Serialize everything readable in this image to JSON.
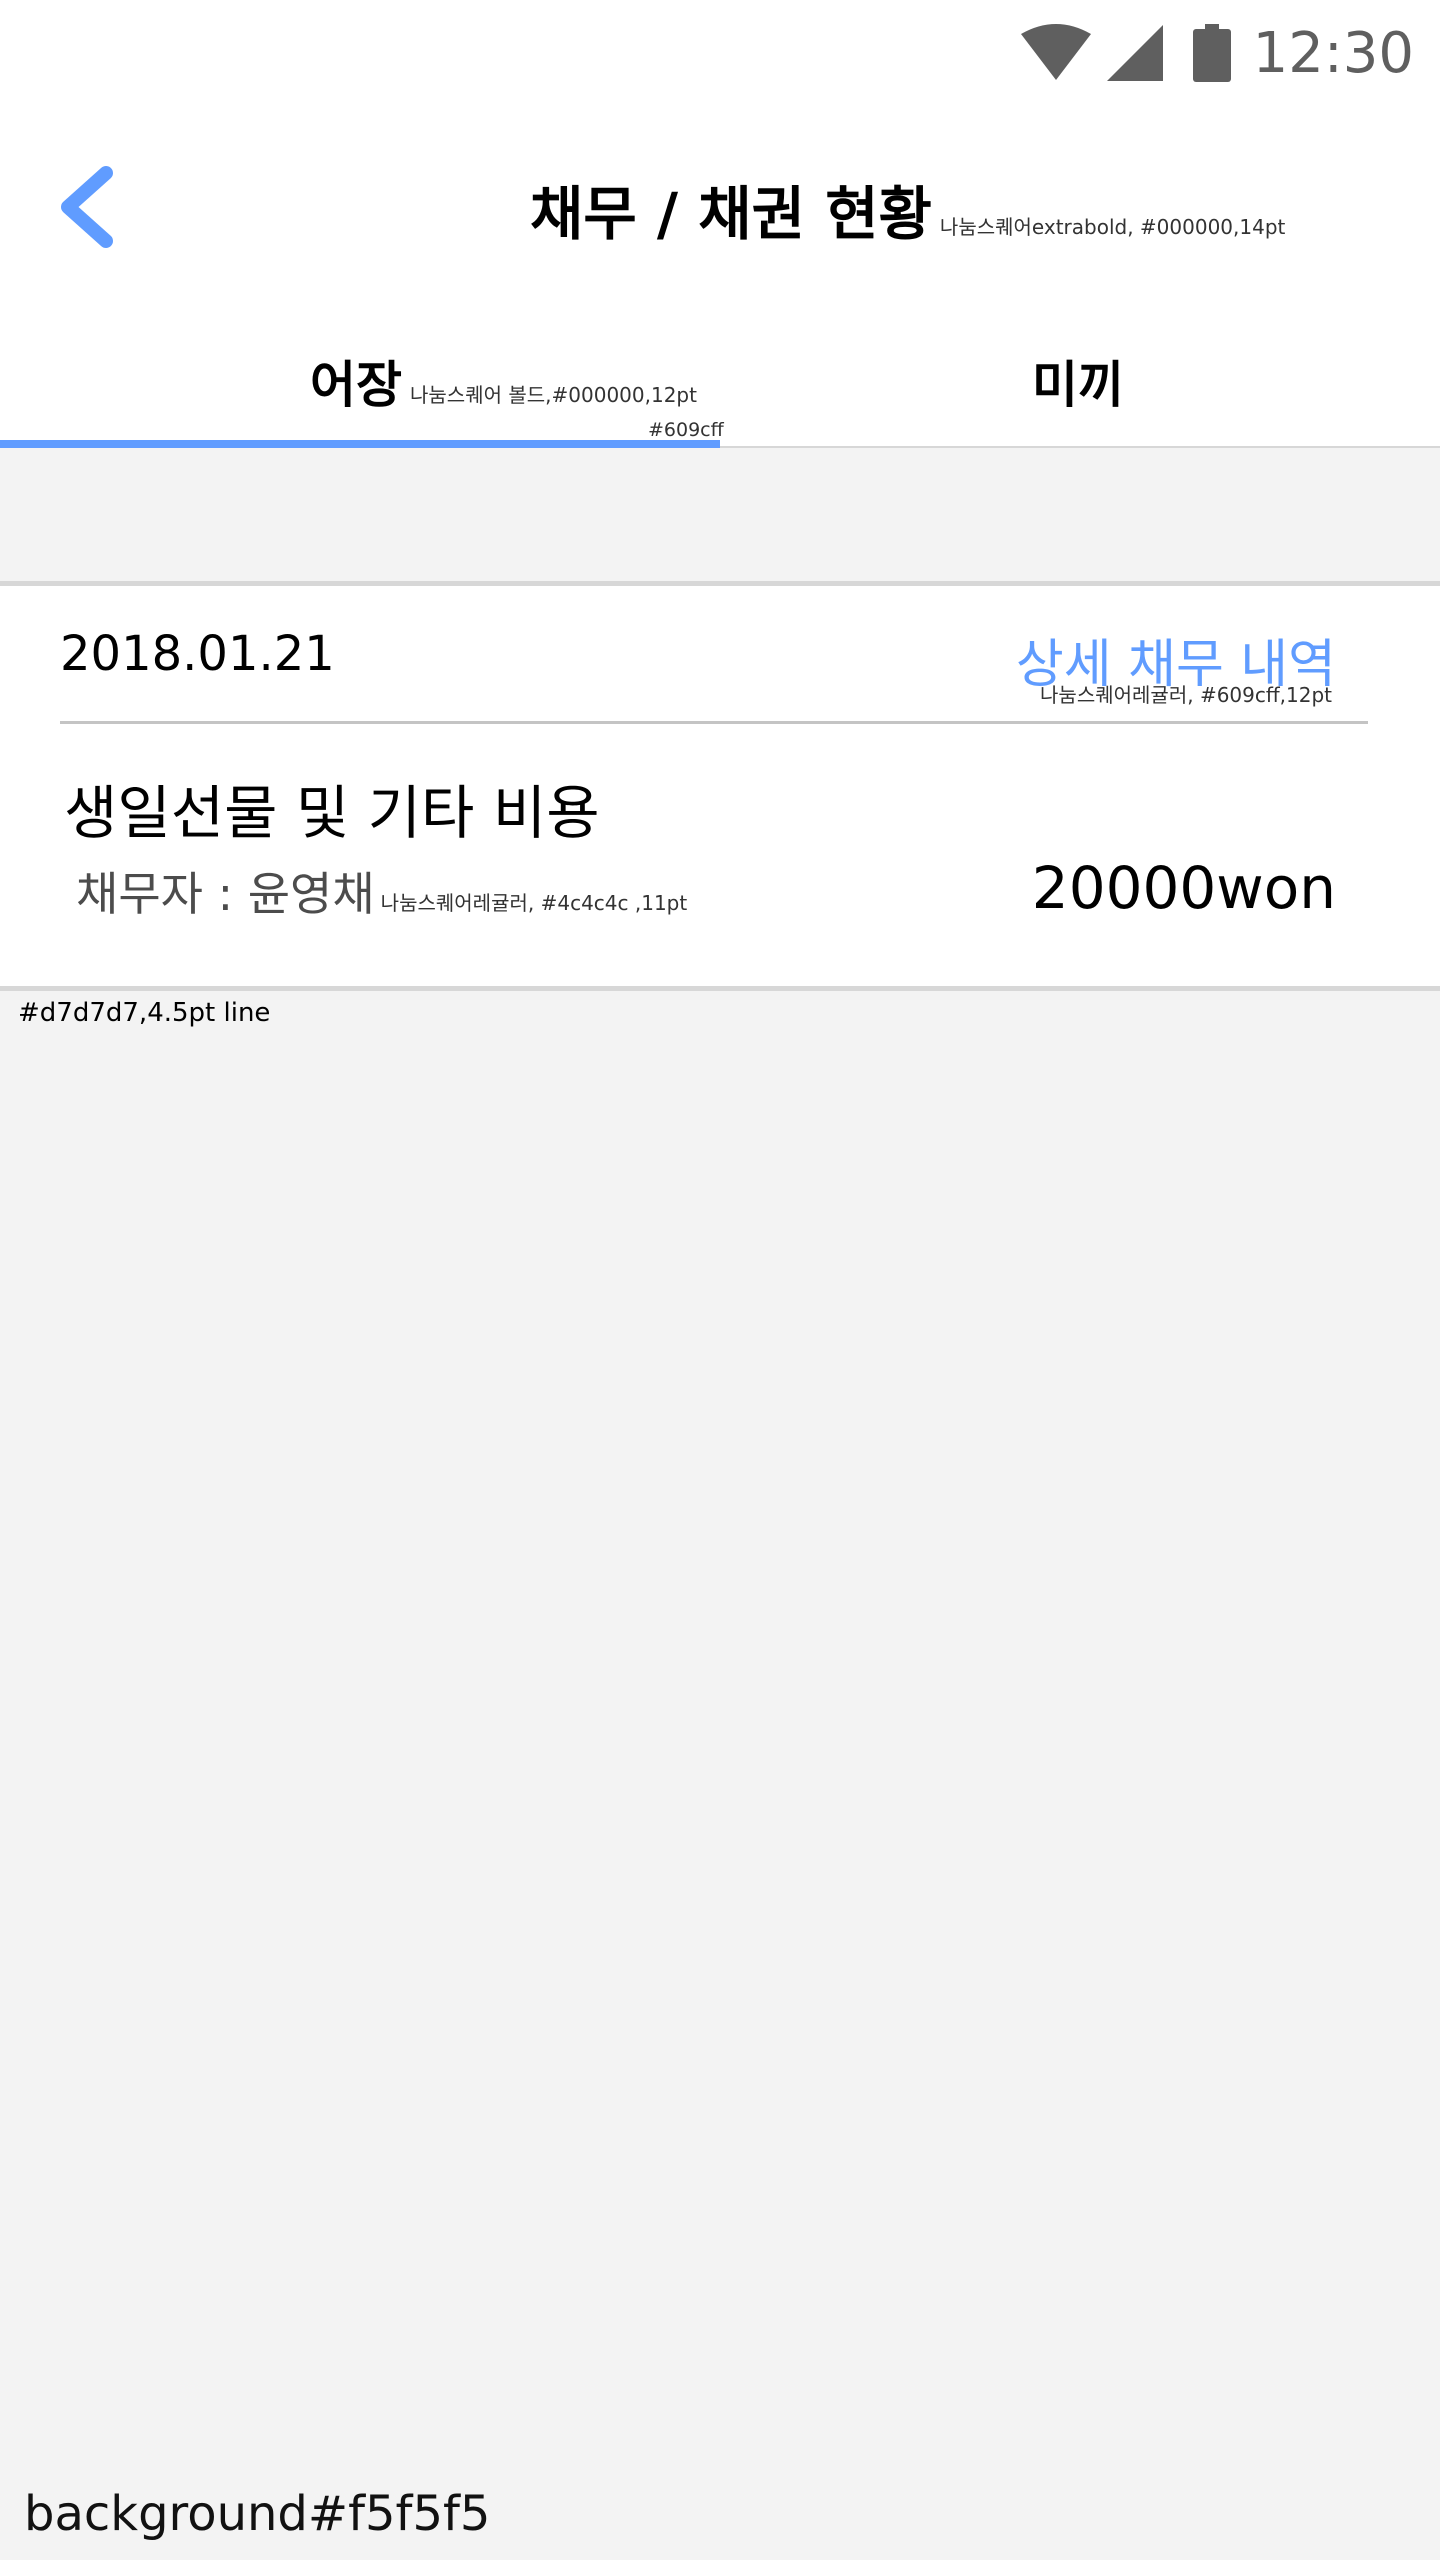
{
  "status_bar": {
    "time": "12:30",
    "icons": [
      "wifi-icon",
      "signal-icon",
      "battery-icon"
    ]
  },
  "header": {
    "title": "채무 / 채권 현황",
    "title_note": "나눔스퀘어extrabold, #000000,14pt",
    "back_icon": "chevron-left-icon"
  },
  "tabs": {
    "items": [
      {
        "label": "어장",
        "note": "나눔스퀘어 볼드,#000000,12pt",
        "active": true
      },
      {
        "label": "미끼",
        "active": false
      }
    ],
    "indicator_note": "#609cff"
  },
  "card": {
    "date": "2018.01.21",
    "detail_link": "상세 채무 내역",
    "detail_note": "나눔스퀘어레귤러, #609cff,12pt",
    "item_title": "생일선물 및 기타 비용",
    "debtor": "채무자 : 윤영채",
    "debtor_note": "나눔스퀘어레귤러, #4c4c4c ,11pt",
    "amount": "20000won"
  },
  "notes": {
    "line_note": "#d7d7d7,4.5pt line",
    "background_note": "background#f5f5f5"
  },
  "colors": {
    "accent": "#609cff",
    "background": "#f5f5f5",
    "divider": "#d7d7d7",
    "secondary_text": "#4c4c4c"
  }
}
